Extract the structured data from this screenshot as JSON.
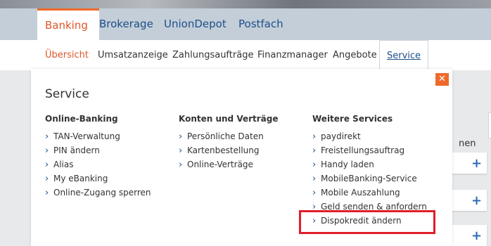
{
  "top_tabs": [
    "Banking",
    "Brokerage",
    "UnionDepot",
    "Postfach"
  ],
  "sub_nav": [
    "Übersicht",
    "Umsatzanzeige",
    "Zahlungsaufträge",
    "Finanzmanager",
    "Angebote",
    "Service"
  ],
  "background": {
    "partial_text": "nen",
    "plus_symbol": "+"
  },
  "panel": {
    "title": "Service",
    "close_symbol": "✕",
    "columns": [
      {
        "heading": "Online-Banking",
        "links": [
          "TAN-Verwaltung",
          "PIN ändern",
          "Alias",
          "My eBanking",
          "Online-Zugang sperren"
        ]
      },
      {
        "heading": "Konten und Verträge",
        "links": [
          "Persönliche Daten",
          "Kartenbestellung",
          "Online-Verträge"
        ]
      },
      {
        "heading": "Weitere Services",
        "links": [
          "paydirekt",
          "Freistellungsauftrag",
          "Handy laden",
          "MobileBanking-Service",
          "Mobile Auszahlung",
          "Geld senden & anfordern",
          "Dispokredit ändern"
        ]
      }
    ]
  },
  "colors": {
    "accent_orange": "#ef6a2a",
    "link_blue": "#1b4f88",
    "highlight_red": "#e01e2a"
  }
}
